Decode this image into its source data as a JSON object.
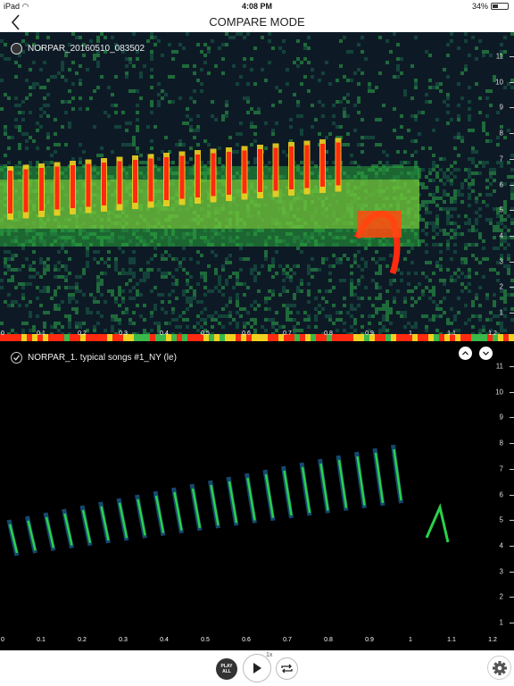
{
  "status_bar": {
    "device": "iPad",
    "time": "4:08 PM",
    "battery": "34%",
    "battery_level": 0.34
  },
  "nav": {
    "title": "COMPARE MODE",
    "back_icon": "chevron-left-icon"
  },
  "recordings": [
    {
      "name": "NORPAR_20160510_083502",
      "selected": false,
      "spectrogram": "color"
    },
    {
      "name": "NORPAR_1. typical songs #1_NY (le)",
      "selected": true,
      "spectrogram": "dark"
    }
  ],
  "freq_axis": [
    "11",
    "10",
    "9",
    "8",
    "7",
    "6",
    "5",
    "4",
    "3",
    "2",
    "1"
  ],
  "time_axis": [
    "0",
    "0.1",
    "0.2",
    "0.3",
    "0.4",
    "0.5",
    "0.6",
    "0.7",
    "0.8",
    "0.9",
    "1",
    "1.1",
    "1.2"
  ],
  "toolbar": {
    "speed": "1x",
    "play_all_line1": "PLAY",
    "play_all_line2": "ALL"
  },
  "colors": {
    "spec_bg": "#0d1a26",
    "dark_bg": "#000000",
    "red": "#ff2a10",
    "green": "#22c44a"
  }
}
